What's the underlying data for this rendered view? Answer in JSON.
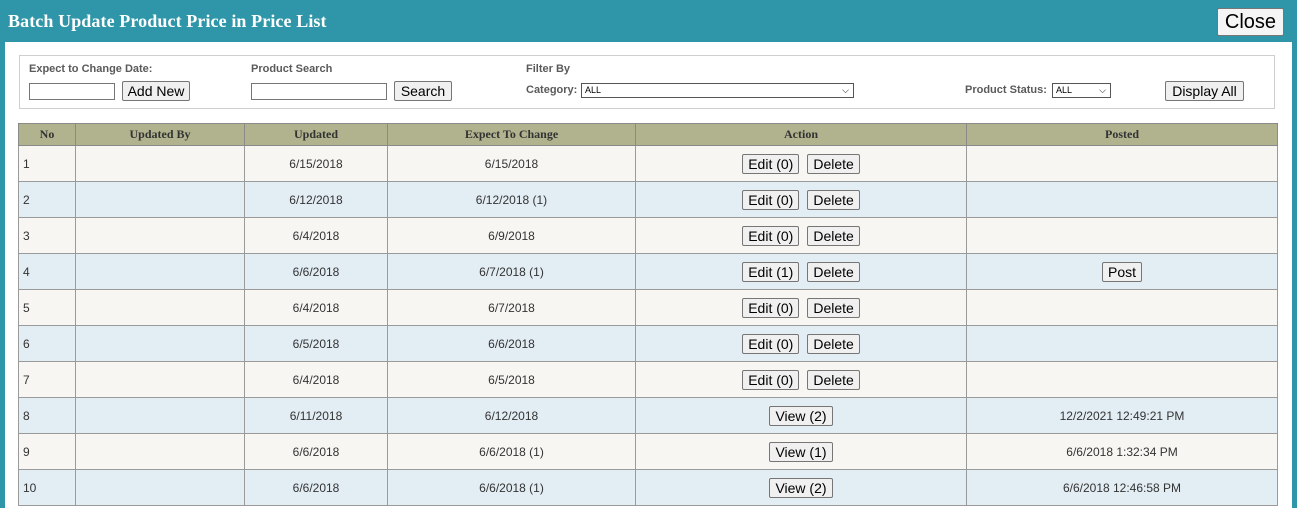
{
  "header": {
    "title": "Batch Update Product Price in Price List",
    "close_label": "Close"
  },
  "filters": {
    "expect_date_label": "Expect to Change Date:",
    "expect_date_value": "",
    "add_new_label": "Add New",
    "product_search_label": "Product Search",
    "product_search_value": "",
    "search_label": "Search",
    "filter_by_label": "Filter By",
    "category_label": "Category:",
    "category_value": "ALL",
    "product_status_label": "Product Status:",
    "product_status_value": "ALL",
    "display_all_label": "Display All"
  },
  "table": {
    "columns": [
      "No",
      "Updated By",
      "Updated",
      "Expect To Change",
      "Action",
      "Posted"
    ],
    "rows": [
      {
        "no": "1",
        "updated_by": "",
        "updated": "6/15/2018",
        "expect": "6/15/2018",
        "mode": "edit",
        "action_label": "Edit (0)",
        "delete_label": "Delete",
        "posted": "",
        "post_label": ""
      },
      {
        "no": "2",
        "updated_by": "",
        "updated": "6/12/2018",
        "expect": "6/12/2018 (1)",
        "mode": "edit",
        "action_label": "Edit (0)",
        "delete_label": "Delete",
        "posted": "",
        "post_label": ""
      },
      {
        "no": "3",
        "updated_by": "",
        "updated": "6/4/2018",
        "expect": "6/9/2018",
        "mode": "edit",
        "action_label": "Edit (0)",
        "delete_label": "Delete",
        "posted": "",
        "post_label": ""
      },
      {
        "no": "4",
        "updated_by": "",
        "updated": "6/6/2018",
        "expect": "6/7/2018 (1)",
        "mode": "edit",
        "action_label": "Edit (1)",
        "delete_label": "Delete",
        "posted": "",
        "post_label": "Post"
      },
      {
        "no": "5",
        "updated_by": "",
        "updated": "6/4/2018",
        "expect": "6/7/2018",
        "mode": "edit",
        "action_label": "Edit (0)",
        "delete_label": "Delete",
        "posted": "",
        "post_label": ""
      },
      {
        "no": "6",
        "updated_by": "",
        "updated": "6/5/2018",
        "expect": "6/6/2018",
        "mode": "edit",
        "action_label": "Edit (0)",
        "delete_label": "Delete",
        "posted": "",
        "post_label": ""
      },
      {
        "no": "7",
        "updated_by": "",
        "updated": "6/4/2018",
        "expect": "6/5/2018",
        "mode": "edit",
        "action_label": "Edit (0)",
        "delete_label": "Delete",
        "posted": "",
        "post_label": ""
      },
      {
        "no": "8",
        "updated_by": "",
        "updated": "6/11/2018",
        "expect": "6/12/2018",
        "mode": "view",
        "action_label": "View (2)",
        "delete_label": "",
        "posted": "12/2/2021 12:49:21 PM",
        "post_label": ""
      },
      {
        "no": "9",
        "updated_by": "",
        "updated": "6/6/2018",
        "expect": "6/6/2018 (1)",
        "mode": "view",
        "action_label": "View (1)",
        "delete_label": "",
        "posted": "6/6/2018 1:32:34 PM",
        "post_label": ""
      },
      {
        "no": "10",
        "updated_by": "",
        "updated": "6/6/2018",
        "expect": "6/6/2018 (1)",
        "mode": "view",
        "action_label": "View (2)",
        "delete_label": "",
        "posted": "6/6/2018 12:46:58 PM",
        "post_label": ""
      }
    ]
  }
}
